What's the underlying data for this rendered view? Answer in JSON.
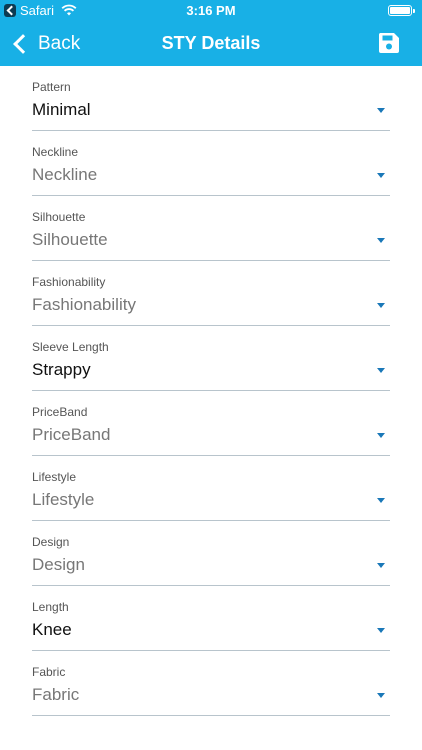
{
  "status_bar": {
    "carrier": "Safari",
    "time": "3:16 PM"
  },
  "nav": {
    "back_label": "Back",
    "title": "STY Details",
    "save_icon": "save-icon"
  },
  "colors": {
    "header": "#18b0e6",
    "dropdown_arrow": "#1a78b8",
    "underline": "#b8c4cc",
    "value_selected": "#111111",
    "value_placeholder": "#777777"
  },
  "fields": [
    {
      "label": "Pattern",
      "value": "Minimal",
      "selected": true
    },
    {
      "label": "Neckline",
      "value": "Neckline",
      "selected": false
    },
    {
      "label": "Silhouette",
      "value": "Silhouette",
      "selected": false
    },
    {
      "label": "Fashionability",
      "value": "Fashionability",
      "selected": false
    },
    {
      "label": "Sleeve Length",
      "value": "Strappy",
      "selected": true
    },
    {
      "label": "PriceBand",
      "value": "PriceBand",
      "selected": false
    },
    {
      "label": "Lifestyle",
      "value": "Lifestyle",
      "selected": false
    },
    {
      "label": "Design",
      "value": "Design",
      "selected": false
    },
    {
      "label": "Length",
      "value": "Knee",
      "selected": true
    },
    {
      "label": "Fabric",
      "value": "Fabric",
      "selected": false
    }
  ]
}
